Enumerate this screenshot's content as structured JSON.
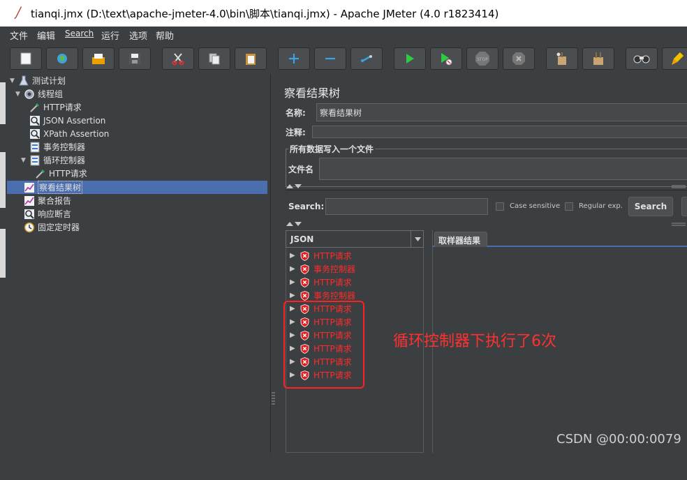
{
  "window": {
    "title": "tianqi.jmx (D:\\text\\apache-jmeter-4.0\\bin\\脚本\\tianqi.jmx) - Apache JMeter (4.0 r1823414)"
  },
  "menu": [
    "文件",
    "编辑",
    "Search",
    "运行",
    "选项",
    "帮助"
  ],
  "toolbar": {
    "icons": [
      "new-icon",
      "templates-icon",
      "open-icon",
      "save-icon",
      "cut-icon",
      "copy-icon",
      "paste-icon",
      "expand-icon",
      "collapse-icon",
      "toggle-icon",
      "start-icon",
      "start-no-pause-icon",
      "stop-icon",
      "shutdown-icon",
      "clear-icon",
      "clear-all-icon",
      "search-icon",
      "reset-search-icon"
    ]
  },
  "tree": {
    "items": [
      {
        "label": "测试计划",
        "icon": "test-plan-icon"
      },
      {
        "label": "线程组",
        "icon": "thread-group-icon"
      },
      {
        "label": "HTTP请求",
        "icon": "sampler-icon"
      },
      {
        "label": "JSON Assertion",
        "icon": "assertion-icon"
      },
      {
        "label": "XPath Assertion",
        "icon": "assertion-icon"
      },
      {
        "label": "事务控制器",
        "icon": "controller-icon"
      },
      {
        "label": "循环控制器",
        "icon": "controller-icon"
      },
      {
        "label": "HTTP请求",
        "icon": "sampler-icon"
      },
      {
        "label": "察看结果树",
        "icon": "listener-icon"
      },
      {
        "label": "聚合报告",
        "icon": "listener-icon"
      },
      {
        "label": "响应断言",
        "icon": "assertion-icon"
      },
      {
        "label": "固定定时器",
        "icon": "timer-icon"
      }
    ]
  },
  "panel": {
    "title": "察看结果树",
    "name_label": "名称:",
    "name_value": "察看结果树",
    "comment_label": "注释:",
    "comment_value": "",
    "file_group_title": "所有数据写入一个文件",
    "filename_label": "文件名",
    "filename_value": "",
    "search_label": "Search:",
    "search_value": "",
    "case_sensitive_label": "Case sensitive",
    "regex_label": "Regular exp.",
    "search_button": "Search",
    "renderer_selected": "JSON",
    "tab_sampler_result": "取样器结果",
    "results": [
      {
        "label": "HTTP请求",
        "status": "error"
      },
      {
        "label": "事务控制器",
        "status": "error"
      },
      {
        "label": "HTTP请求",
        "status": "error"
      },
      {
        "label": "事务控制器",
        "status": "error"
      },
      {
        "label": "HTTP请求",
        "status": "error"
      },
      {
        "label": "HTTP请求",
        "status": "error"
      },
      {
        "label": "HTTP请求",
        "status": "error"
      },
      {
        "label": "HTTP请求",
        "status": "error"
      },
      {
        "label": "HTTP请求",
        "status": "error"
      },
      {
        "label": "HTTP请求",
        "status": "error"
      }
    ]
  },
  "annotation": {
    "text": "循环控制器下执行了6次",
    "color": "#ff3030"
  },
  "watermark": "CSDN @00:00:0079"
}
